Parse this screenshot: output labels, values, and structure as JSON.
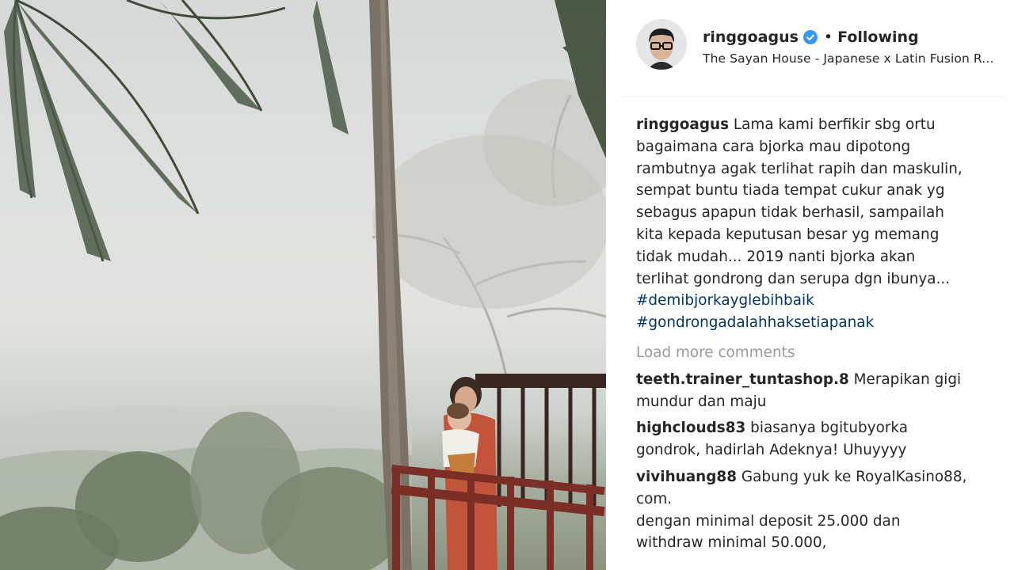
{
  "post": {
    "photo_icon": "post-photo"
  },
  "header": {
    "username": "ringgoagus",
    "verified_icon": "verified-badge-icon",
    "separator": "•",
    "follow_label": "Following",
    "location": "The Sayan House - Japanese x Latin Fusion Restaurant",
    "colors": {
      "verified": "#3897f0",
      "text": "#262626"
    }
  },
  "caption": {
    "username": "ringgoagus",
    "lines": [
      "Lama kami berfikir sbg ortu",
      "bagaimana cara bjorka mau dipotong",
      "rambutnya agak terlihat rapih dan maskulin,",
      "sempat buntu tiada tempat cukur anak yg",
      "sebagus apapun tidak berhasil, sampailah",
      "kita kepada keputusan besar yg memang",
      "tidak mudah... 2019 nanti bjorka akan",
      "terlihat gondrong dan serupa dgn ibunya..."
    ],
    "hashtags": [
      "#demibjorkayglebihbaik",
      "#gondrongadalahhaksetiapanak"
    ],
    "colors": {
      "hashtag": "#003569"
    }
  },
  "load_more": "Load more comments",
  "comments": [
    {
      "username": "teeth.trainer_tuntashop.8",
      "first": "Merapikan gigi",
      "rest": [
        "mundur dan maju"
      ]
    },
    {
      "username": "highclouds83",
      "first": "biasanya bgitubyorka",
      "rest": [
        "gondrok, hadirlah Adeknya! Uhuyyyy"
      ]
    },
    {
      "username": "vivihuang88",
      "first": "Gabung yuk ke RoyalKasino88,",
      "rest": [
        "com.",
        "dengan minimal deposit 25.000 dan",
        "withdraw minimal 50.000,"
      ]
    }
  ]
}
